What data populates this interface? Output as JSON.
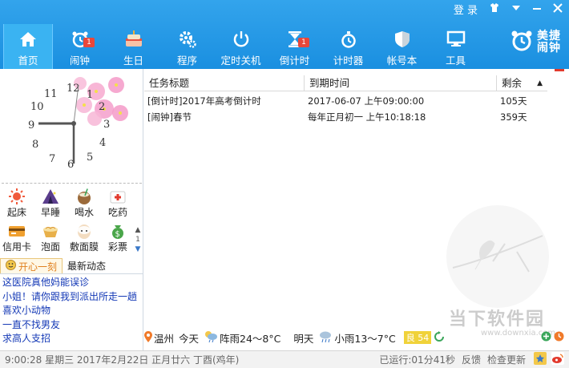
{
  "window": {
    "login_label": "登 录"
  },
  "nav": {
    "items": [
      {
        "label": "首页"
      },
      {
        "label": "闹钟",
        "badge": "1"
      },
      {
        "label": "生日"
      },
      {
        "label": "程序"
      },
      {
        "label": "定时关机"
      },
      {
        "label": "倒计时",
        "badge": "1"
      },
      {
        "label": "计时器"
      },
      {
        "label": "帐号本"
      },
      {
        "label": "工具"
      }
    ]
  },
  "brand": {
    "line1": "美捷",
    "line2": "闹钟"
  },
  "clock": {
    "numbers": [
      "12",
      "1",
      "2",
      "3",
      "4",
      "5",
      "6",
      "7",
      "8",
      "9",
      "10",
      "11"
    ]
  },
  "quick_actions": [
    {
      "label": "起床",
      "icon": "sun-icon"
    },
    {
      "label": "早睡",
      "icon": "tent-icon"
    },
    {
      "label": "喝水",
      "icon": "coconut-icon"
    },
    {
      "label": "吃药",
      "icon": "medicine-icon"
    },
    {
      "label": "信用卡",
      "icon": "credit-card-icon"
    },
    {
      "label": "泡面",
      "icon": "noodle-icon"
    },
    {
      "label": "敷面膜",
      "icon": "face-mask-icon"
    },
    {
      "label": "彩票",
      "icon": "lottery-icon"
    }
  ],
  "quick_page": "1",
  "tabs": {
    "tab1": "开心一刻",
    "tab2": "最新动态"
  },
  "news": [
    "这医院真他妈能误诊",
    "小姐！请你跟我到派出所走一趟",
    "喜欢小动物",
    "一直不找男友",
    "求高人支招"
  ],
  "table": {
    "headers": [
      "任务标题",
      "到期时间",
      "剩余"
    ],
    "rows": [
      {
        "title": "[倒计时]2017年高考倒计时",
        "due": "2017-06-07 上午09:00:00",
        "remain": "105天"
      },
      {
        "title": "[闹钟]春节",
        "due": "每年正月初一 上午10:18:18",
        "remain": "359天"
      }
    ]
  },
  "weather": {
    "city": "温州",
    "today_label": "今天",
    "today": "阵雨24～8°C",
    "tomorrow_label": "明天",
    "tomorrow": "小雨13～7°C",
    "aqi": "良 54"
  },
  "status": {
    "datetime": "9:00:28 星期三 2017年2月22日 正月廿六 丁酉(鸡年)",
    "running": "已运行:01分41秒",
    "feedback": "反馈",
    "update": "检查更新"
  },
  "watermark": {
    "text": "当下软件园",
    "url": "www.downxia.com"
  },
  "colors": {
    "header": "#1a8fe0",
    "link": "#1439b6",
    "accent_orange": "#e0801f",
    "aqi": "#f0d23a"
  }
}
